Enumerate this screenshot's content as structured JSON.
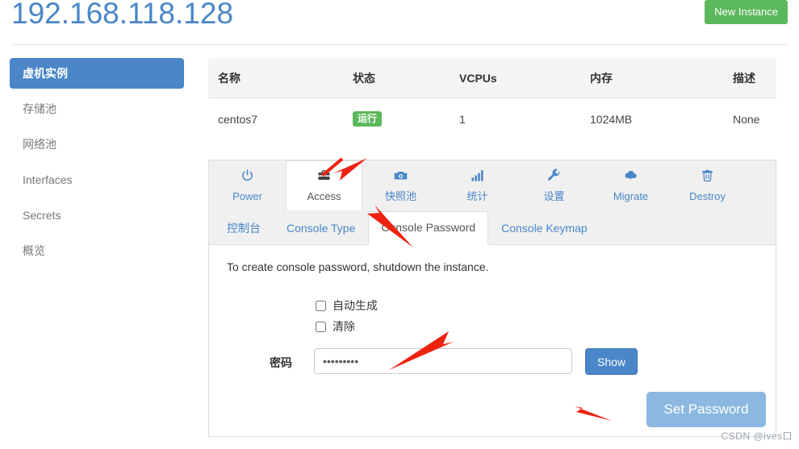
{
  "header": {
    "title": "192.168.118.128",
    "new_instance_label": "New Instance",
    "title_color": "#4a86c8",
    "new_instance_color": "#5cb85c"
  },
  "sidebar": {
    "items": [
      {
        "label": "虚机实例",
        "active": true
      },
      {
        "label": "存储池",
        "active": false
      },
      {
        "label": "网络池",
        "active": false
      },
      {
        "label": "Interfaces",
        "active": false
      },
      {
        "label": "Secrets",
        "active": false
      },
      {
        "label": "概览",
        "active": false
      }
    ]
  },
  "instance_table": {
    "columns": [
      "名称",
      "状态",
      "VCPUs",
      "内存",
      "描述"
    ],
    "rows": [
      {
        "name": "centos7",
        "state": "运行",
        "state_color": "#5cb85c",
        "vcpus": "1",
        "memory": "1024MB",
        "description": "None"
      }
    ]
  },
  "icon_tabs": [
    {
      "label": "Power",
      "icon": "power-icon",
      "glyph": "⏻",
      "active": false
    },
    {
      "label": "Access",
      "icon": "briefcase-icon",
      "glyph": "💼",
      "active": true
    },
    {
      "label": "快照池",
      "icon": "camera-icon",
      "glyph": "📷",
      "active": false
    },
    {
      "label": "统计",
      "icon": "bar-chart-icon",
      "glyph": "▂▄▆",
      "active": false
    },
    {
      "label": "设置",
      "icon": "wrench-icon",
      "glyph": "🔧",
      "active": false
    },
    {
      "label": "Migrate",
      "icon": "cloud-download-icon",
      "glyph": "☁",
      "active": false
    },
    {
      "label": "Destroy",
      "icon": "trash-icon",
      "glyph": "🗑",
      "active": false
    }
  ],
  "sub_tabs": [
    {
      "label": "控制台",
      "active": false
    },
    {
      "label": "Console Type",
      "active": false
    },
    {
      "label": "Console Password",
      "active": true
    },
    {
      "label": "Console Keymap",
      "active": false
    }
  ],
  "console_password_form": {
    "note": "To create console password, shutdown the instance.",
    "auto_generate_label": "自动生成",
    "auto_generate_checked": false,
    "clear_label": "清除",
    "clear_checked": false,
    "password_label": "密码",
    "password_value": "•••••••••",
    "password_placeholder": "",
    "show_button_label": "Show",
    "set_password_label": "Set Password"
  },
  "watermark": "CSDN @ives口"
}
